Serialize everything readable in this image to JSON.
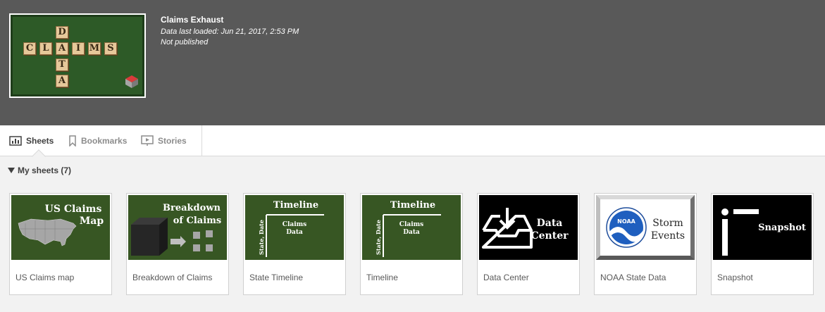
{
  "app": {
    "title": "Claims Exhaust",
    "data_loaded": "Data last loaded: Jun 21, 2017, 2:53 PM",
    "status": "Not published",
    "thumbnail_letters_across": [
      "C",
      "L",
      "A",
      "I",
      "M",
      "S"
    ],
    "thumbnail_letters_down": [
      "D",
      "A",
      "T",
      "A"
    ]
  },
  "tabs": [
    {
      "label": "Sheets",
      "icon": "sheets-icon",
      "active": true
    },
    {
      "label": "Bookmarks",
      "icon": "bookmark-icon",
      "active": false
    },
    {
      "label": "Stories",
      "icon": "stories-icon",
      "active": false
    }
  ],
  "section": {
    "label": "My sheets (7)"
  },
  "sheets": [
    {
      "label": "US Claims map",
      "thumb_text": [
        "US Claims",
        "Map"
      ],
      "thumb_bg": "#375623"
    },
    {
      "label": "Breakdown of Claims",
      "thumb_text": [
        "Breakdown",
        "of Claims"
      ],
      "thumb_bg": "#375623"
    },
    {
      "label": "State Timeline",
      "thumb_text": [
        "Timeline",
        "Claims",
        "Data",
        "State, Date"
      ],
      "thumb_bg": "#375623"
    },
    {
      "label": "Timeline",
      "thumb_text": [
        "Timeline",
        "Claims",
        "Data",
        "State, Date"
      ],
      "thumb_bg": "#375623"
    },
    {
      "label": "Data Center",
      "thumb_text": [
        "Data",
        "Center"
      ],
      "thumb_bg": "#000000"
    },
    {
      "label": "NOAA State Data",
      "thumb_text": [
        "Storm",
        "Events",
        "NOAA"
      ],
      "thumb_bg": "#e8e8e8"
    },
    {
      "label": "Snapshot",
      "thumb_text": [
        "Snapshot"
      ],
      "thumb_bg": "#000000"
    }
  ],
  "colors": {
    "header_bg": "#595959",
    "thumb_green": "#375623",
    "tile": "#e6c89a"
  }
}
